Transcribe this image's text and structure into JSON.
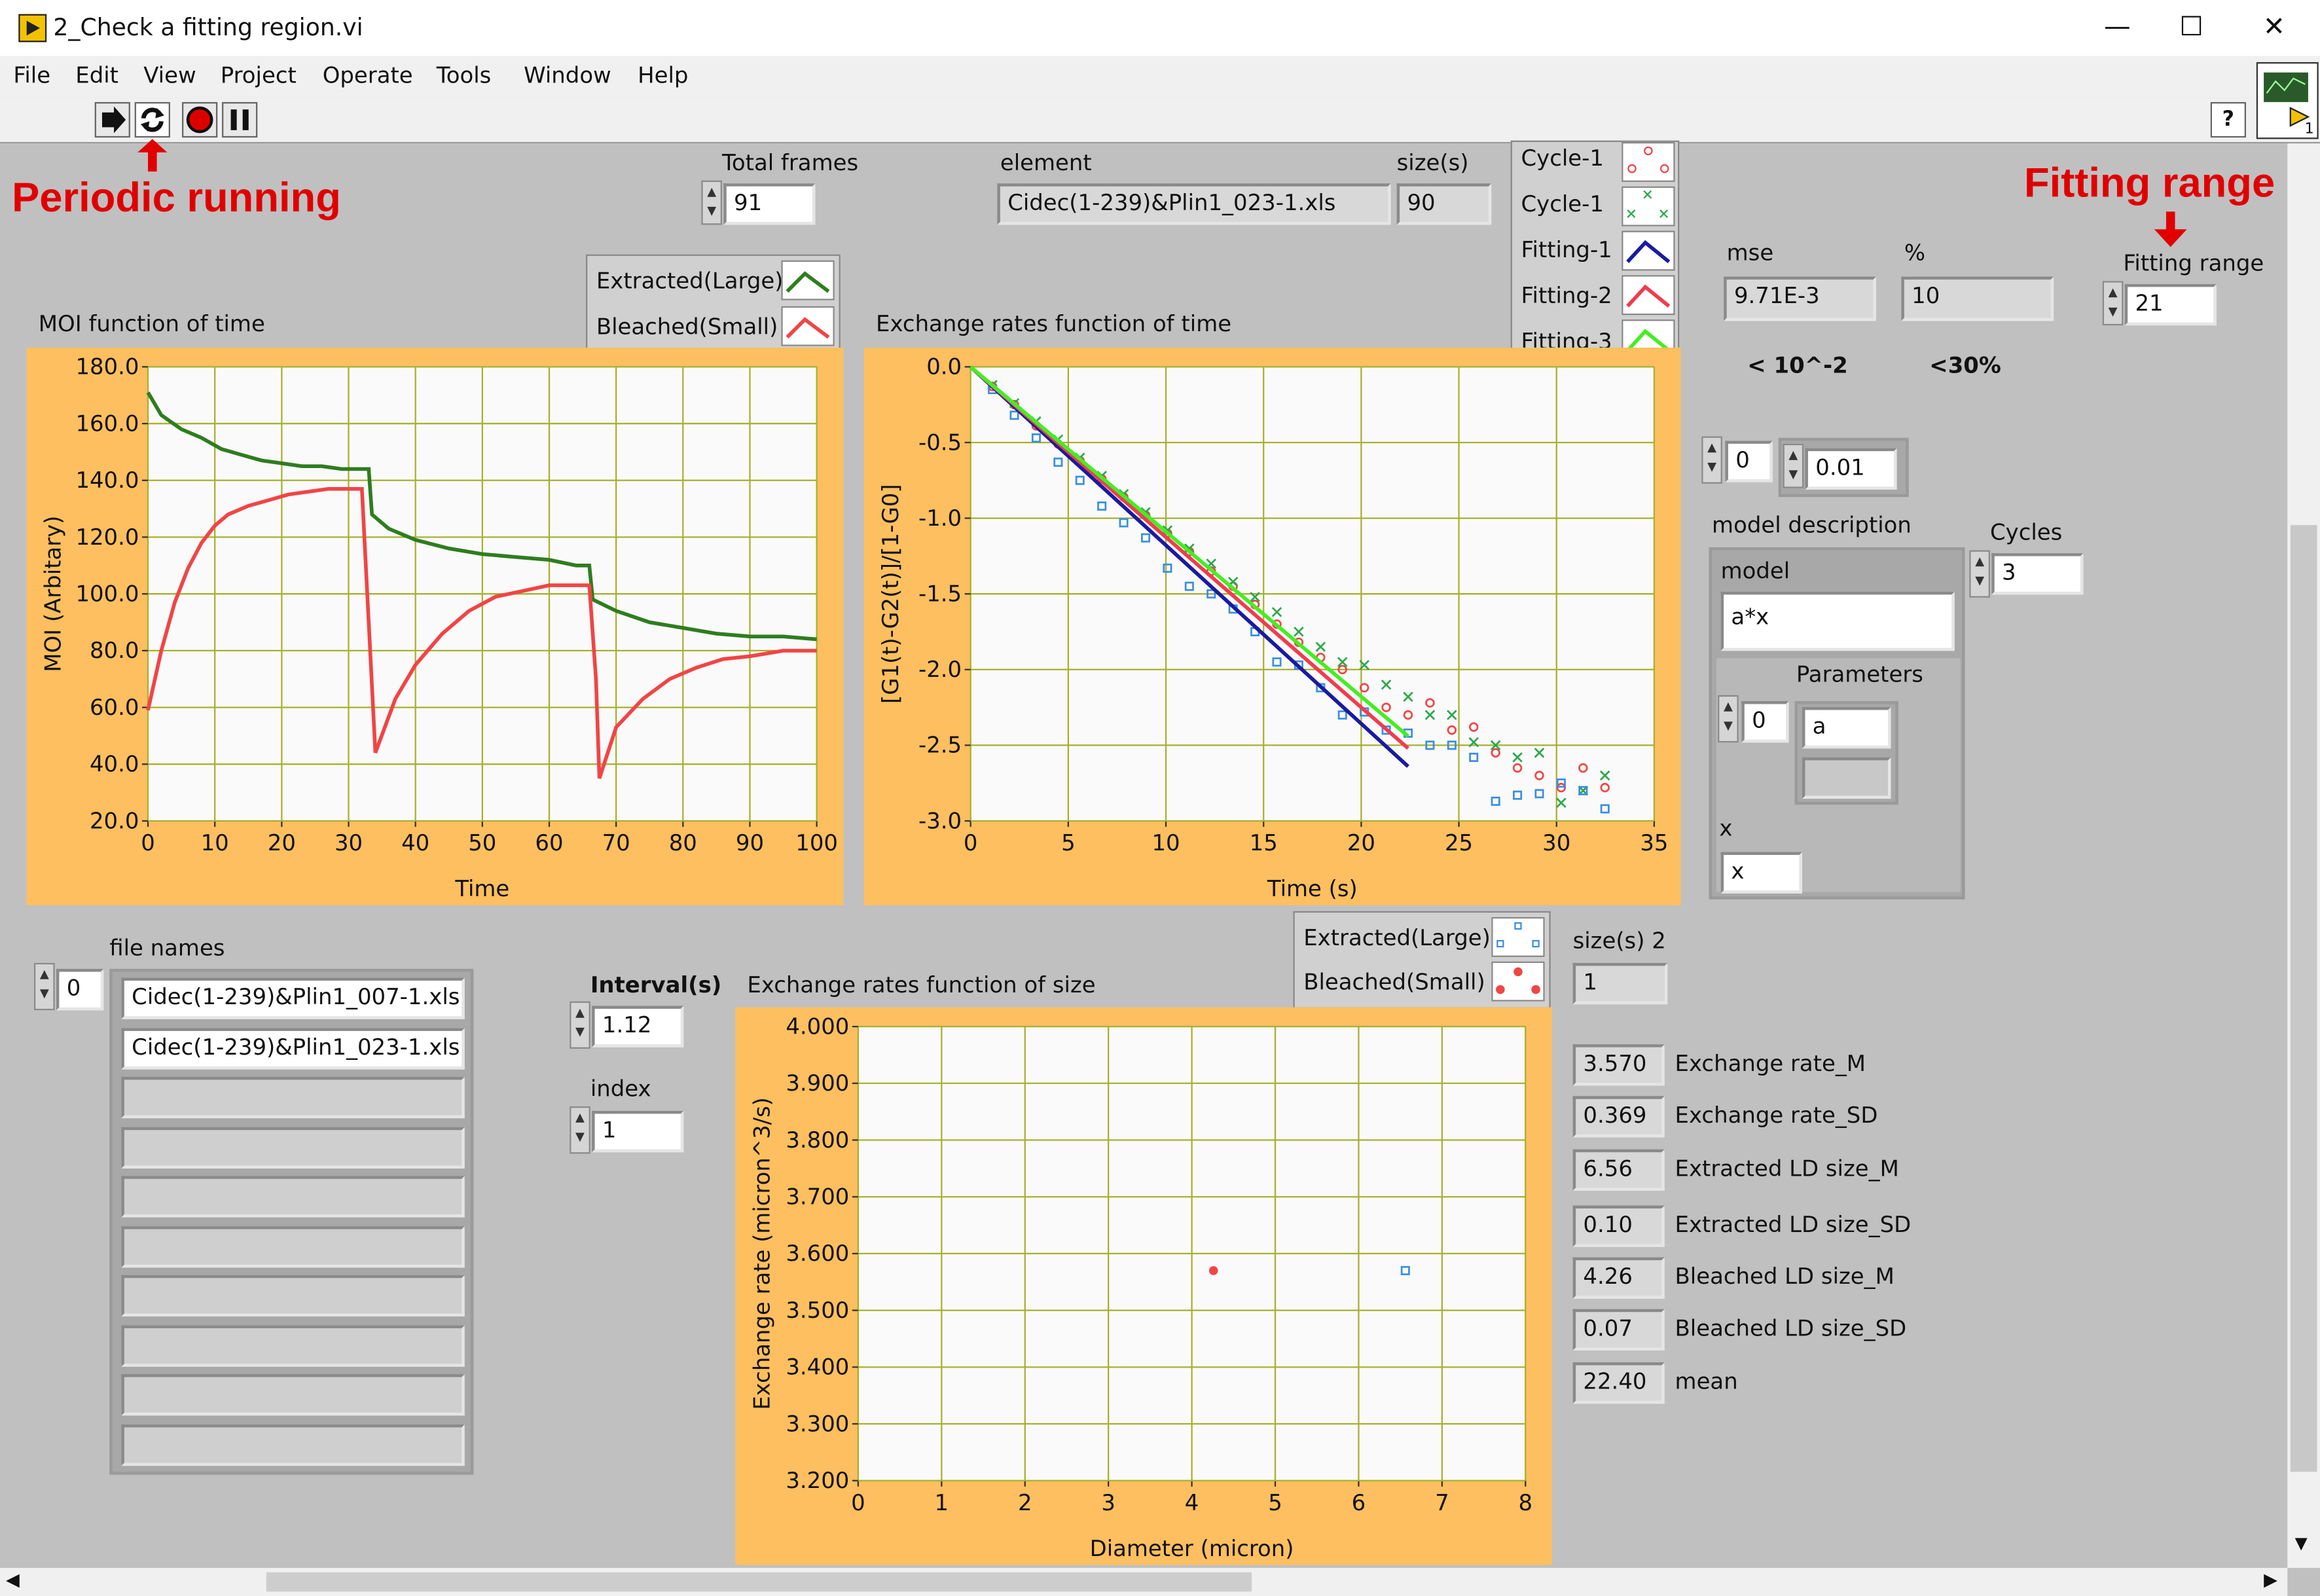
{
  "window": {
    "title": "2_Check a fitting region.vi",
    "minimize_glyph": "—",
    "maximize_glyph": "☐",
    "close_glyph": "✕"
  },
  "menu": [
    "File",
    "Edit",
    "View",
    "Project",
    "Operate",
    "Tools",
    "Window",
    "Help"
  ],
  "toolbar": {
    "run_icon": "run-arrow-icon",
    "run_continuous_icon": "run-continuously-icon",
    "abort_icon": "abort-icon",
    "pause_icon": "pause-icon",
    "help_glyph": "?",
    "vi_icon_badge": "1"
  },
  "annotations": {
    "periodic_running": "Periodic running",
    "fitting_range": "Fitting range"
  },
  "controls": {
    "total_frames": {
      "label": "Total frames",
      "value": "91"
    },
    "element": {
      "label": "element",
      "value": "Cidec(1-239)&Plin1_023-1.xls"
    },
    "size": {
      "label": "size(s)",
      "value": "90"
    },
    "mse": {
      "label": "mse",
      "value": "9.71E-3",
      "note": "< 10^-2"
    },
    "percent": {
      "label": "%",
      "value": "10",
      "note": "<30%"
    },
    "fitting_range": {
      "label": "Fitting range",
      "value": "21"
    },
    "index_a": "0",
    "tolerance": "0.01",
    "model_description": {
      "label": "model description",
      "model_label": "model",
      "model_value": "a*x",
      "parameters_label": "Parameters",
      "param_index": "0",
      "param_value": "a",
      "x_label": "x",
      "x_value": "x"
    },
    "cycles": {
      "label": "Cycles",
      "value": "3"
    },
    "file_names": {
      "label": "file names",
      "index": "0",
      "items": [
        "Cidec(1-239)&Plin1_007-1.xls",
        "Cidec(1-239)&Plin1_023-1.xls",
        "",
        "",
        "",
        "",
        "",
        "",
        "",
        ""
      ]
    },
    "interval": {
      "label": "Interval(s)",
      "value": "1.12"
    },
    "index": {
      "label": "index",
      "value": "1"
    },
    "size2": {
      "label": "size(s) 2",
      "value": "1"
    },
    "results": [
      {
        "value": "3.570",
        "label": "Exchange rate_M"
      },
      {
        "value": "0.369",
        "label": "Exchange rate_SD"
      },
      {
        "value": "6.56",
        "label": "Extracted LD size_M"
      },
      {
        "value": "0.10",
        "label": "Extracted LD size_SD"
      },
      {
        "value": "4.26",
        "label": "Bleached LD size_M"
      },
      {
        "value": "0.07",
        "label": "Bleached LD size_SD"
      },
      {
        "value": "22.40",
        "label": "mean"
      }
    ]
  },
  "legends": {
    "moi": [
      "Extracted(Large)",
      "Bleached(Small)"
    ],
    "exchange_time": [
      "Cycle-1",
      "Cycle-1",
      "Fitting-1",
      "Fitting-2",
      "Fitting-3"
    ],
    "exchange_size": [
      "Extracted(Large)",
      "Bleached(Small)"
    ]
  },
  "colors": {
    "plot_frame": "#fdbf5f",
    "plot_bg": "#fafafa",
    "grid": "#a8b030",
    "extracted_green": "#2e7d1e",
    "bleached_red": "#f04545",
    "fit_navy": "#1a1aa0",
    "fit_red": "#f03c50",
    "fit_lime": "#44ee22",
    "marker_blue": "#3a8ee0",
    "annotation_red": "#e00000"
  },
  "chart_data": [
    {
      "type": "line",
      "title": "MOI function of time",
      "xlabel": "Time",
      "ylabel": "MOI (Arbitary)",
      "xlim": [
        0,
        100
      ],
      "ylim": [
        20,
        180
      ],
      "xticks": [
        "0",
        "10",
        "20",
        "30",
        "40",
        "50",
        "60",
        "70",
        "80",
        "90",
        "100"
      ],
      "yticks": [
        "20.0",
        "40.0",
        "60.0",
        "80.0",
        "100.0",
        "120.0",
        "140.0",
        "160.0",
        "180.0"
      ],
      "grid": true,
      "legend_position": "top-right",
      "series": [
        {
          "name": "Extracted(Large)",
          "color": "#2e7d1e",
          "x": [
            0,
            2,
            5,
            8,
            11,
            14,
            17,
            20,
            23,
            26,
            29,
            31,
            33,
            33.5,
            36,
            40,
            45,
            50,
            55,
            60,
            64,
            66,
            66.5,
            70,
            75,
            80,
            85,
            90,
            95,
            100
          ],
          "y": [
            171,
            163,
            158,
            155,
            151,
            149,
            147,
            146,
            145,
            145,
            144,
            144,
            144,
            128,
            123,
            119,
            116,
            114,
            113,
            112,
            110,
            110,
            98,
            94,
            90,
            88,
            86,
            85,
            85,
            84
          ]
        },
        {
          "name": "Bleached(Small)",
          "color": "#f04545",
          "x": [
            0,
            2,
            4,
            6,
            8,
            10,
            12,
            15,
            18,
            21,
            24,
            27,
            30,
            32,
            33,
            34,
            37,
            40,
            44,
            48,
            52,
            56,
            60,
            63,
            66,
            67,
            67.5,
            70,
            74,
            78,
            82,
            86,
            90,
            95,
            100
          ],
          "y": [
            59,
            80,
            97,
            109,
            118,
            124,
            128,
            131,
            133,
            135,
            136,
            137,
            137,
            137,
            90,
            44,
            63,
            75,
            86,
            94,
            99,
            101,
            103,
            103,
            103,
            70,
            35,
            53,
            63,
            70,
            74,
            77,
            78,
            80,
            80
          ]
        }
      ]
    },
    {
      "type": "scatter",
      "title": "Exchange rates function of time",
      "xlabel": "Time (s)",
      "ylabel": "[G1(t)-G2(t)]/[1-G0]",
      "xlim": [
        0,
        35
      ],
      "ylim": [
        -3.0,
        0.0
      ],
      "xticks": [
        "0",
        "5",
        "10",
        "15",
        "20",
        "25",
        "30",
        "35"
      ],
      "yticks": [
        "-3.0",
        "-2.5",
        "-2.0",
        "-1.5",
        "-1.0",
        "-0.5",
        "0.0"
      ],
      "grid": true,
      "legend_position": "top-right",
      "series": [
        {
          "name": "Cycle-1",
          "marker": "circle",
          "color": "#f04545",
          "x": [
            1.12,
            2.24,
            3.36,
            4.48,
            5.6,
            6.72,
            7.84,
            8.96,
            10.08,
            11.2,
            12.32,
            13.44,
            14.56,
            15.68,
            16.8,
            17.92,
            19.04,
            20.16,
            21.28,
            22.4,
            23.52,
            24.64,
            25.76,
            26.88,
            28.0,
            29.12,
            30.24,
            31.36,
            32.48
          ],
          "y": [
            -0.13,
            -0.25,
            -0.39,
            -0.51,
            -0.62,
            -0.74,
            -0.86,
            -0.98,
            -1.1,
            -1.22,
            -1.35,
            -1.45,
            -1.57,
            -1.7,
            -1.82,
            -1.92,
            -2.0,
            -2.12,
            -2.25,
            -2.3,
            -2.22,
            -2.4,
            -2.38,
            -2.55,
            -2.65,
            -2.7,
            -2.78,
            -2.65,
            -2.78
          ]
        },
        {
          "name": "Cycle-1",
          "marker": "cross",
          "color": "#2aa84a",
          "x": [
            1.12,
            2.24,
            3.36,
            4.48,
            5.6,
            6.72,
            7.84,
            8.96,
            10.08,
            11.2,
            12.32,
            13.44,
            14.56,
            15.68,
            16.8,
            17.92,
            19.04,
            20.16,
            21.28,
            22.4,
            23.52,
            24.64,
            25.76,
            26.88,
            28.0,
            29.12,
            30.24,
            31.36,
            32.48
          ],
          "y": [
            -0.12,
            -0.24,
            -0.36,
            -0.48,
            -0.6,
            -0.72,
            -0.84,
            -0.96,
            -1.08,
            -1.2,
            -1.3,
            -1.42,
            -1.52,
            -1.62,
            -1.75,
            -1.85,
            -1.95,
            -1.97,
            -2.1,
            -2.18,
            -2.3,
            -2.3,
            -2.48,
            -2.5,
            -2.58,
            -2.55,
            -2.88,
            -2.8,
            -2.7
          ]
        },
        {
          "name": "Cycle-1",
          "marker": "square",
          "color": "#3a8ee0",
          "x": [
            1.12,
            2.24,
            3.36,
            4.48,
            5.6,
            6.72,
            7.84,
            8.96,
            10.08,
            11.2,
            12.32,
            13.44,
            14.56,
            15.68,
            16.8,
            17.92,
            19.04,
            20.16,
            21.28,
            22.4,
            23.52,
            24.64,
            25.76,
            26.88,
            28.0,
            29.12,
            30.24,
            31.36,
            32.48
          ],
          "y": [
            -0.15,
            -0.32,
            -0.47,
            -0.63,
            -0.75,
            -0.92,
            -1.03,
            -1.13,
            -1.33,
            -1.45,
            -1.5,
            -1.6,
            -1.75,
            -1.95,
            -1.97,
            -2.12,
            -2.3,
            -2.28,
            -2.4,
            -2.42,
            -2.5,
            -2.5,
            -2.58,
            -2.87,
            -2.83,
            -2.82,
            -2.75,
            -2.8,
            -2.92
          ]
        },
        {
          "name": "Fitting-1",
          "type": "line",
          "color": "#1a1aa0",
          "x": [
            0,
            22.4
          ],
          "y": [
            0,
            -2.64
          ]
        },
        {
          "name": "Fitting-2",
          "type": "line",
          "color": "#f03c50",
          "x": [
            0,
            22.4
          ],
          "y": [
            0,
            -2.52
          ]
        },
        {
          "name": "Fitting-3",
          "type": "line",
          "color": "#44ee22",
          "x": [
            0,
            22.4
          ],
          "y": [
            0,
            -2.44
          ]
        }
      ]
    },
    {
      "type": "scatter",
      "title": "Exchange rates function of size",
      "xlabel": "Diameter (micron)",
      "ylabel": "Exchange rate (micron^3/s)",
      "xlim": [
        0,
        8
      ],
      "ylim": [
        3.2,
        4.0
      ],
      "xticks": [
        "0",
        "1",
        "2",
        "3",
        "4",
        "5",
        "6",
        "7",
        "8"
      ],
      "yticks": [
        "3.200",
        "3.300",
        "3.400",
        "3.500",
        "3.600",
        "3.700",
        "3.800",
        "3.900",
        "4.000"
      ],
      "grid": true,
      "legend_position": "top-right",
      "series": [
        {
          "name": "Extracted(Large)",
          "marker": "square",
          "color": "#3a8ee0",
          "x": [
            6.56
          ],
          "y": [
            3.57
          ]
        },
        {
          "name": "Bleached(Small)",
          "marker": "dot",
          "color": "#f04545",
          "x": [
            4.26
          ],
          "y": [
            3.57
          ]
        }
      ]
    }
  ]
}
